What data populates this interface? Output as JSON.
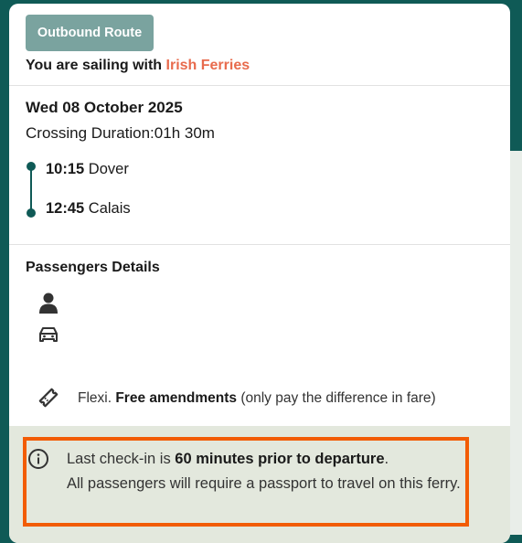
{
  "route_badge": "Outbound Route",
  "sailing": {
    "prefix": "You are sailing with ",
    "operator": "Irish Ferries"
  },
  "trip": {
    "date": "Wed 08 October 2025",
    "duration": "Crossing Duration:01h 30m",
    "departure": {
      "time": "10:15",
      "port": "Dover"
    },
    "arrival": {
      "time": "12:45",
      "port": "Calais"
    }
  },
  "passengers": {
    "title": "Passengers Details",
    "icons": [
      "person-icon",
      "car-icon"
    ]
  },
  "fare": {
    "icon": "ticket-icon",
    "prefix": "Flexi. ",
    "bold": "Free amendments",
    "suffix": " (only pay the difference in fare)"
  },
  "info": {
    "icon": "info-icon",
    "line1_prefix": "Last check-in is ",
    "line1_bold": "60 minutes prior to departure",
    "line1_suffix": ".",
    "line2": "All passengers will require a passport to travel on this ferry."
  },
  "colors": {
    "teal": "#0f5a56",
    "badge": "#7aa39f",
    "operator": "#e86b4d",
    "highlight": "#f25c05",
    "info_bg": "#e3e8dd"
  }
}
